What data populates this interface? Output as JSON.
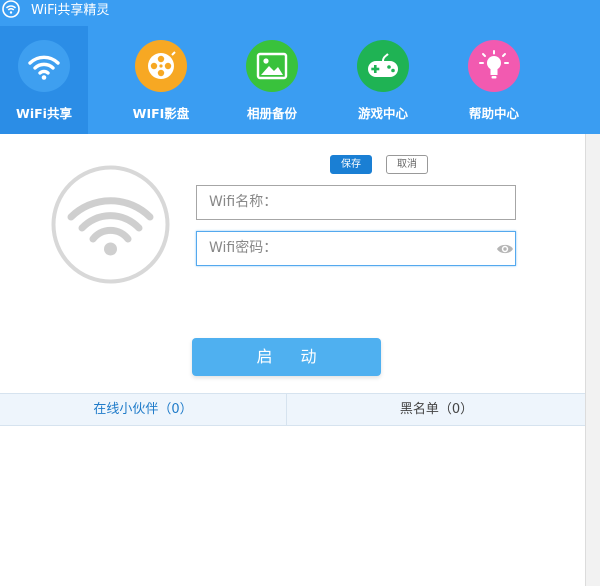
{
  "window": {
    "title": "WiFi共享精灵"
  },
  "nav": {
    "tabs": [
      {
        "label": "WiFi共享",
        "icon": "wifi-icon",
        "color": "#3a9df2",
        "active": true
      },
      {
        "label": "WIFI影盘",
        "icon": "film-reel-icon",
        "color": "#f7a823"
      },
      {
        "label": "相册备份",
        "icon": "image-icon",
        "color": "#39c23c"
      },
      {
        "label": "游戏中心",
        "icon": "gamepad-icon",
        "color": "#1fb354"
      },
      {
        "label": "帮助中心",
        "icon": "lightbulb-icon",
        "color": "#f25ab0"
      }
    ]
  },
  "form": {
    "save_label": "保存",
    "cancel_label": "取消",
    "wifi_name_placeholder": "Wifi名称：",
    "wifi_password_placeholder": "Wifi密码：",
    "start_label": "启动"
  },
  "lists": {
    "online_tab": "在线小伙伴（0）",
    "blacklist_tab": "黑名单（0）"
  },
  "colors": {
    "header_bg": "#3a9df2",
    "active_tab_bg": "#2b8de6",
    "save_btn": "#1a7fd4",
    "start_btn": "#4fb0f0"
  }
}
